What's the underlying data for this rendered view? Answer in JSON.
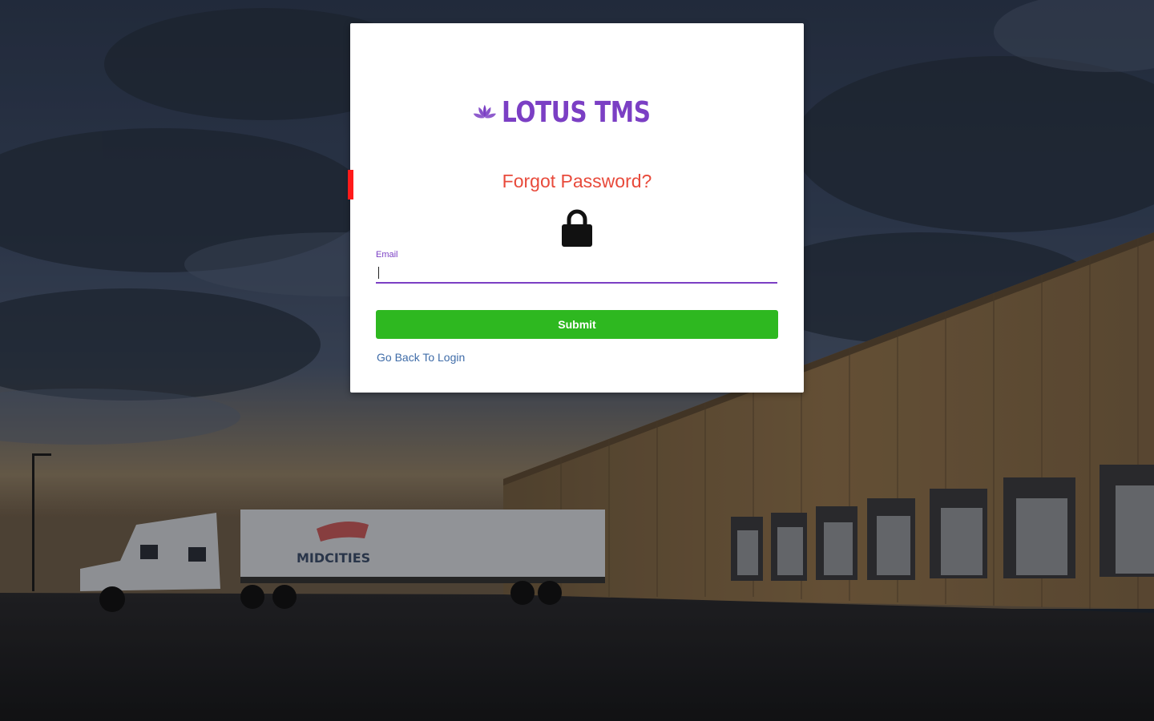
{
  "brand": {
    "logo_text": "LOTUS TMS",
    "color": "#7b3fc4"
  },
  "form": {
    "title": "Forgot Password?",
    "title_color": "#e84a3b",
    "icon": "lock-icon",
    "email_label": "Email",
    "email_value": "",
    "submit_label": "Submit",
    "submit_color": "#2eb820",
    "back_link_label": "Go Back To Login",
    "link_color": "#3f6ca8"
  },
  "background": {
    "trailer_text": "MIDCITIES"
  }
}
